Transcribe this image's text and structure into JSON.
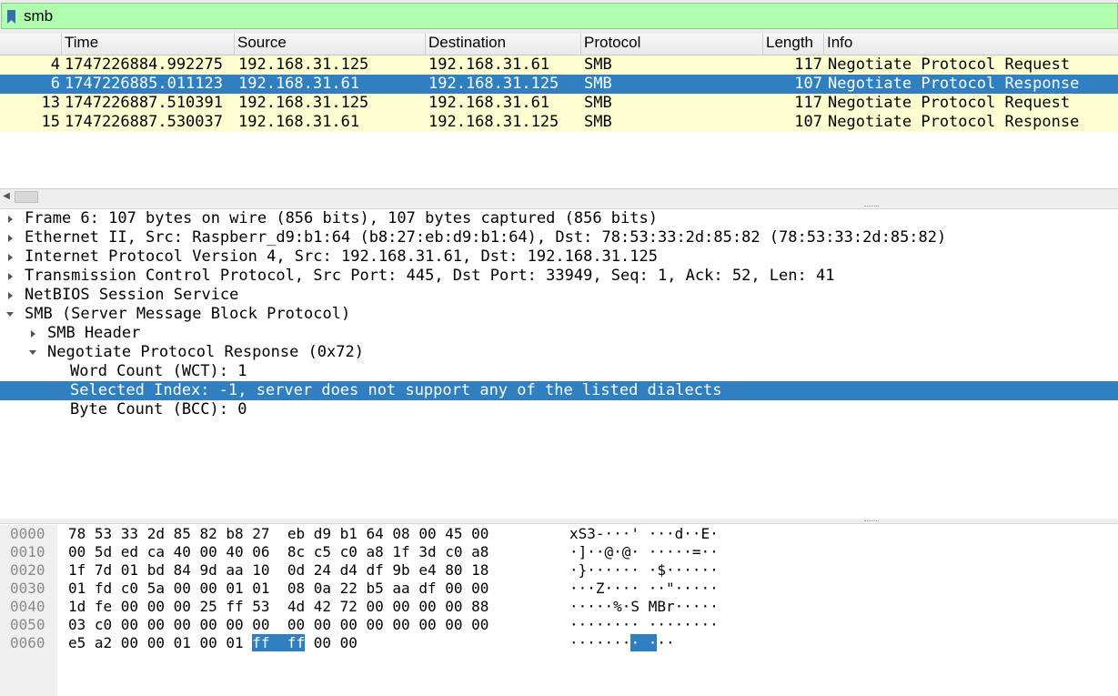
{
  "filter": {
    "value": "smb",
    "icon": "bookmark-icon"
  },
  "packet_list": {
    "columns": [
      "",
      "Time",
      "Source",
      "Destination",
      "Protocol",
      "Length",
      "Info"
    ],
    "rows": [
      {
        "no": "4",
        "time": "1747226884.992275",
        "source": "192.168.31.125",
        "destination": "192.168.31.61",
        "protocol": "SMB",
        "length": "117",
        "info": "Negotiate Protocol Request",
        "selected": false
      },
      {
        "no": "6",
        "time": "1747226885.011123",
        "source": "192.168.31.61",
        "destination": "192.168.31.125",
        "protocol": "SMB",
        "length": "107",
        "info": "Negotiate Protocol Response",
        "selected": true
      },
      {
        "no": "13",
        "time": "1747226887.510391",
        "source": "192.168.31.125",
        "destination": "192.168.31.61",
        "protocol": "SMB",
        "length": "117",
        "info": "Negotiate Protocol Request",
        "selected": false
      },
      {
        "no": "15",
        "time": "1747226887.530037",
        "source": "192.168.31.61",
        "destination": "192.168.31.125",
        "protocol": "SMB",
        "length": "107",
        "info": "Negotiate Protocol Response",
        "selected": false
      }
    ],
    "row_color": "#feffd0",
    "selected_color": "#2f7fc1"
  },
  "details": [
    {
      "text": "Frame 6: 107 bytes on wire (856 bits), 107 bytes captured (856 bits)",
      "state": "collapsed",
      "level": 0
    },
    {
      "text": "Ethernet II, Src: Raspberr_d9:b1:64 (b8:27:eb:d9:b1:64), Dst: 78:53:33:2d:85:82 (78:53:33:2d:85:82)",
      "state": "collapsed",
      "level": 0
    },
    {
      "text": "Internet Protocol Version 4, Src: 192.168.31.61, Dst: 192.168.31.125",
      "state": "collapsed",
      "level": 0
    },
    {
      "text": "Transmission Control Protocol, Src Port: 445, Dst Port: 33949, Seq: 1, Ack: 52, Len: 41",
      "state": "collapsed",
      "level": 0
    },
    {
      "text": "NetBIOS Session Service",
      "state": "collapsed",
      "level": 0
    },
    {
      "text": "SMB (Server Message Block Protocol)",
      "state": "expanded",
      "level": 0
    },
    {
      "text": "SMB Header",
      "state": "collapsed",
      "level": 1
    },
    {
      "text": "Negotiate Protocol Response (0x72)",
      "state": "expanded",
      "level": 1
    },
    {
      "text": "Word Count (WCT): 1",
      "state": "leaf",
      "level": 2
    },
    {
      "text": "Selected Index: -1, server does not support any of the listed dialects",
      "state": "leaf",
      "level": 2,
      "selected": true
    },
    {
      "text": "Byte Count (BCC): 0",
      "state": "leaf",
      "level": 2
    }
  ],
  "bytes": [
    {
      "offset": "0000",
      "hex": "78 53 33 2d 85 82 b8 27  eb d9 b1 64 08 00 45 00",
      "ascii": "xS3-···' ···d··E·"
    },
    {
      "offset": "0010",
      "hex": "00 5d ed ca 40 00 40 06  8c c5 c0 a8 1f 3d c0 a8",
      "ascii": "·]··@·@· ·····=··"
    },
    {
      "offset": "0020",
      "hex": "1f 7d 01 bd 84 9d aa 10  0d 24 d4 df 9b e4 80 18",
      "ascii": "·}······ ·$······"
    },
    {
      "offset": "0030",
      "hex": "01 fd c0 5a 00 00 01 01  08 0a 22 b5 aa df 00 00",
      "ascii": "···Z···· ··\"·····"
    },
    {
      "offset": "0040",
      "hex": "1d fe 00 00 00 25 ff 53  4d 42 72 00 00 00 00 88",
      "ascii": "·····%·S MBr·····"
    },
    {
      "offset": "0050",
      "hex": "03 c0 00 00 00 00 00 00  00 00 00 00 00 00 00 00",
      "ascii": "········ ········"
    },
    {
      "offset": "0060",
      "hex_pre": "e5 a2 00 00 01 00 01 ",
      "hex_hl": "ff  ff",
      "hex_post": " 00 00",
      "ascii_pre": "·······",
      "ascii_hl": "· ·",
      "ascii_post": "··"
    }
  ]
}
